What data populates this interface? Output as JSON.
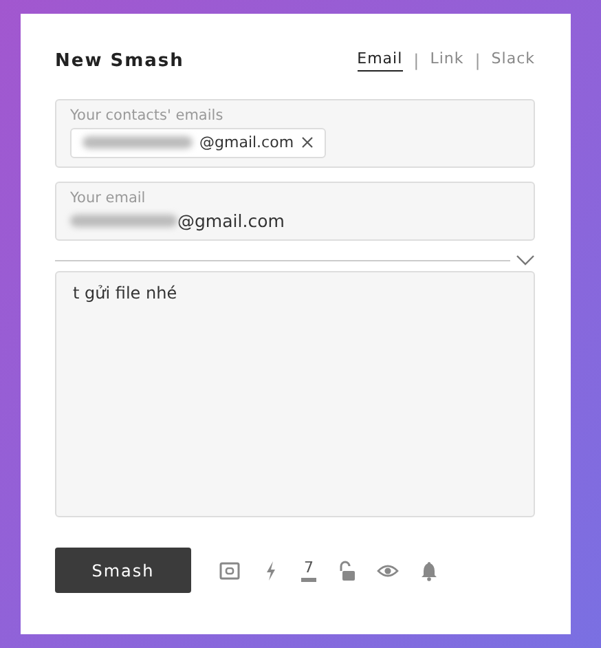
{
  "title": "New Smash",
  "tabs": [
    {
      "label": "Email",
      "selected": true
    },
    {
      "label": "Link",
      "selected": false
    },
    {
      "label": "Slack",
      "selected": false
    }
  ],
  "tab_separator": "|",
  "contacts_field": {
    "label": "Your contacts' emails",
    "chips": [
      {
        "text": "@gmail.com",
        "redacted": true
      }
    ]
  },
  "email_field": {
    "label": "Your email",
    "value": "@gmail.com",
    "redacted": true
  },
  "message": {
    "value": "t gửi file nhé"
  },
  "send_button": "Smash",
  "days": "7"
}
